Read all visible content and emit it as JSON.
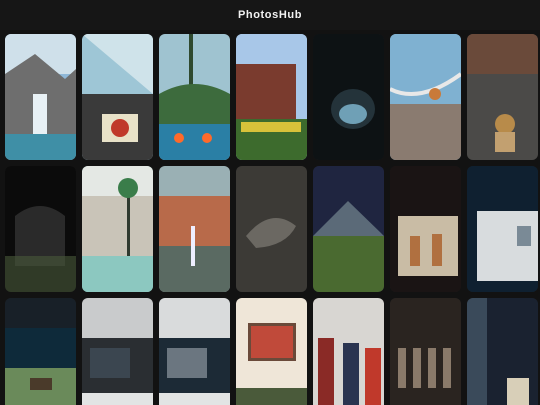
{
  "app": {
    "title": "PhotosHub"
  },
  "photos": [
    {
      "name": "photo-waterpark-rocks",
      "row": 1,
      "scene": "rocks-waterfall",
      "colors": [
        "#8fb8d8",
        "#6e6e6e",
        "#3f8fa6"
      ]
    },
    {
      "name": "photo-carousel-signboard",
      "row": 1,
      "scene": "ride-sign",
      "colors": [
        "#9ec6d6",
        "#3a3a3a",
        "#c0392b"
      ]
    },
    {
      "name": "photo-fountain-palms",
      "row": 1,
      "scene": "fountain-palms",
      "colors": [
        "#9fc3d0",
        "#3d6b3d",
        "#2a7fa5"
      ]
    },
    {
      "name": "photo-garden-building",
      "row": 1,
      "scene": "garden-house",
      "colors": [
        "#a8c7e8",
        "#7a3b2e",
        "#d8c23a"
      ]
    },
    {
      "name": "photo-cave-opening",
      "row": 1,
      "scene": "cave",
      "colors": [
        "#0d1214",
        "#24333a",
        "#6fa0b6"
      ]
    },
    {
      "name": "photo-rollercoaster-indoor",
      "row": 1,
      "scene": "coaster",
      "colors": [
        "#7fb1d1",
        "#8a7b70",
        "#c97a3a"
      ]
    },
    {
      "name": "photo-shop-bear",
      "row": 1,
      "scene": "shop-bear",
      "colors": [
        "#4b4a48",
        "#b88b4a",
        "#c2a070"
      ]
    },
    {
      "name": "photo-dark-interior",
      "row": 2,
      "scene": "dark",
      "colors": [
        "#0b0b0b",
        "#2a2a2a",
        "#4a5a3a"
      ]
    },
    {
      "name": "photo-pool-palms",
      "row": 2,
      "scene": "pool-palms",
      "colors": [
        "#8cc8c0",
        "#3a7d4a",
        "#c9c4b8"
      ]
    },
    {
      "name": "photo-fountain-plaza",
      "row": 2,
      "scene": "fountain-plaza",
      "colors": [
        "#9ab0b4",
        "#5a6a62",
        "#c8c8c8"
      ]
    },
    {
      "name": "photo-dinosaur-fossil",
      "row": 2,
      "scene": "fossil",
      "colors": [
        "#3c3a36",
        "#55524c",
        "#8a8780"
      ]
    },
    {
      "name": "photo-volcano-diorama",
      "row": 2,
      "scene": "volcano",
      "colors": [
        "#1f2540",
        "#5b6a78",
        "#4a6a30"
      ]
    },
    {
      "name": "photo-cavemen-diorama",
      "row": 2,
      "scene": "cavemen",
      "colors": [
        "#1a1414",
        "#b07040",
        "#c9bca5"
      ]
    },
    {
      "name": "photo-museum-display-case",
      "row": 2,
      "scene": "display",
      "colors": [
        "#0f2030",
        "#d8dcde",
        "#7a8a96"
      ]
    },
    {
      "name": "photo-diorama-wagon",
      "row": 3,
      "scene": "diorama",
      "colors": [
        "#182028",
        "#6a8a5a",
        "#4a3a2a"
      ]
    },
    {
      "name": "photo-museum-room-1",
      "row": 3,
      "scene": "room",
      "colors": [
        "#2a2e32",
        "#c9cbcc",
        "#3b4650"
      ]
    },
    {
      "name": "photo-museum-room-2",
      "row": 3,
      "scene": "room-bright",
      "colors": [
        "#1c2a36",
        "#d9dbdc",
        "#6b7680"
      ]
    },
    {
      "name": "photo-painting-wall",
      "row": 3,
      "scene": "painting",
      "colors": [
        "#efe6d8",
        "#c04a3a",
        "#8a6a4a"
      ]
    },
    {
      "name": "photo-costumes",
      "row": 3,
      "scene": "costumes",
      "colors": [
        "#d8d6d2",
        "#8a2a26",
        "#2a3450"
      ]
    },
    {
      "name": "photo-hanging-artifacts",
      "row": 3,
      "scene": "hanging",
      "colors": [
        "#2a2420",
        "#5a4e44",
        "#8a7a6a"
      ]
    },
    {
      "name": "photo-stone-sculptures",
      "row": 3,
      "scene": "sculptures",
      "colors": [
        "#1a2230",
        "#3a4a5a",
        "#d8cfb8"
      ]
    }
  ]
}
